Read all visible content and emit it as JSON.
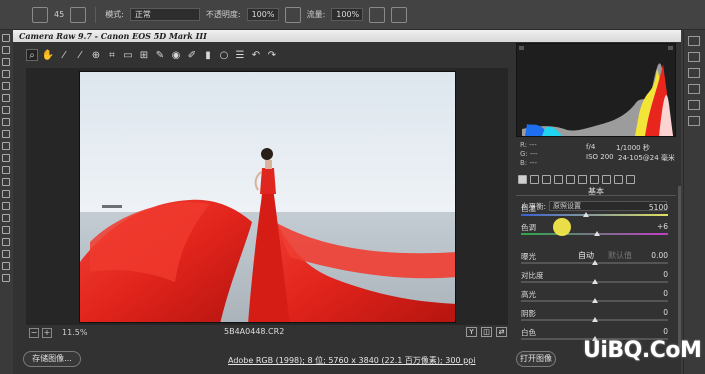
{
  "ps_options": {
    "mode_label": "模式:",
    "mode_value": "正常",
    "opacity_label": "不透明度:",
    "opacity_value": "100%",
    "flow_label": "流量:",
    "flow_value": "100%",
    "brush_size": "45"
  },
  "dialog": {
    "title": "Camera Raw 9.7 -  Canon EOS 5D Mark III"
  },
  "preview": {
    "zoom": "11.5%",
    "filename": "5B4A0448.CR2"
  },
  "camera_info": {
    "r": "R: ---",
    "g": "G: ---",
    "b": "B: ---",
    "aperture": "f/4",
    "shutter": "1/1000 秒",
    "iso": "ISO 200",
    "lens": "24-105@24 毫米"
  },
  "panel": {
    "section_title": "基本",
    "wb_label": "白平衡:",
    "wb_value": "原照设置",
    "auto_label": "自动",
    "default_label": "默认值"
  },
  "sliders": [
    {
      "name": "色温",
      "value": "5100",
      "fraction": 0.44
    },
    {
      "name": "色调",
      "value": "+6",
      "fraction": 0.52
    },
    {
      "name": "曝光",
      "value": "0.00",
      "fraction": 0.5
    },
    {
      "name": "对比度",
      "value": "0",
      "fraction": 0.5
    },
    {
      "name": "高光",
      "value": "0",
      "fraction": 0.5
    },
    {
      "name": "阴影",
      "value": "0",
      "fraction": 0.5
    },
    {
      "name": "白色",
      "value": "0",
      "fraction": 0.5
    }
  ],
  "bottom": {
    "save_label": "存储图像...",
    "workflow_text": "Adobe RGB (1998); 8 位; 5760 x 3840 (22.1 百万像素); 300 ppi",
    "open_label": "打开图像"
  },
  "watermark": "UiBQ.CoM",
  "colors": {
    "dialog_bg": "#323232",
    "accent_red": "#e8261e",
    "cursor_yellow": "#f4e84a"
  }
}
